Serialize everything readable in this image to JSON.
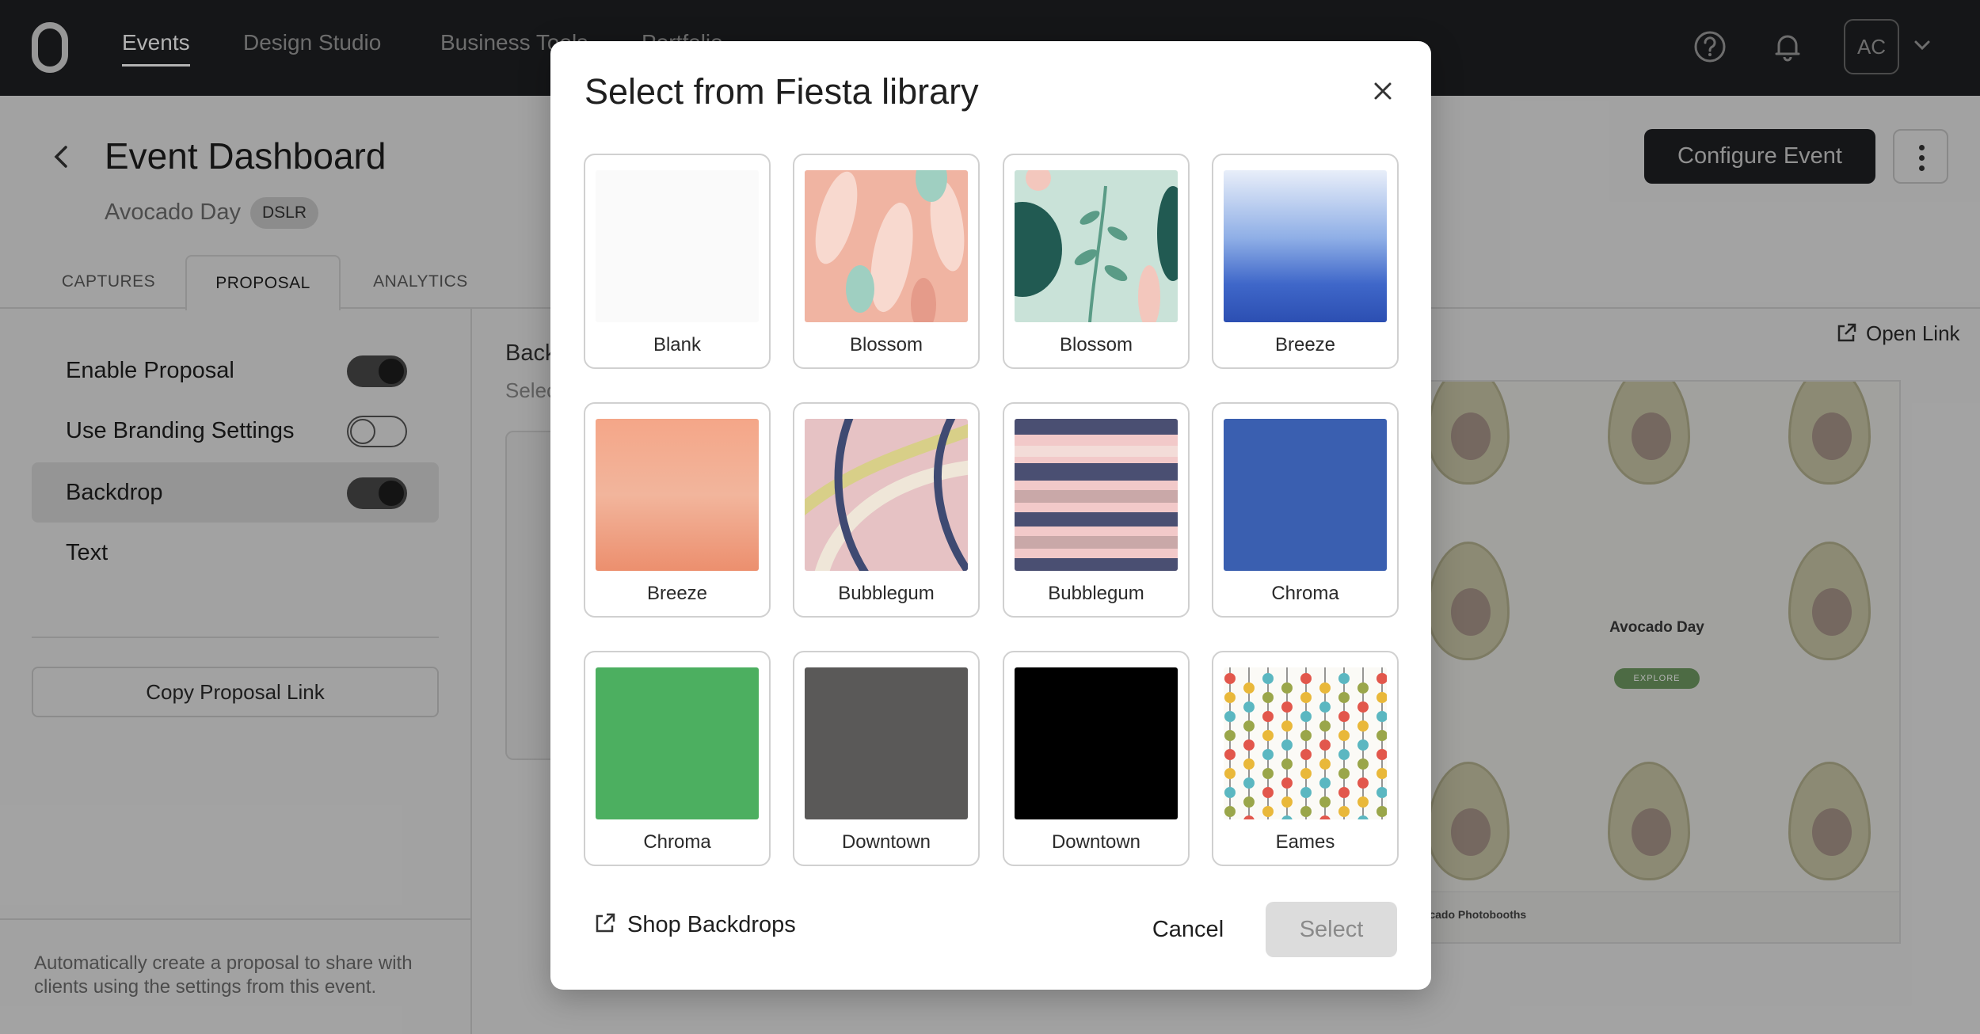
{
  "nav": {
    "items": [
      "Events",
      "Design Studio",
      "Business Tools",
      "Portfolio"
    ],
    "active": "Events",
    "avatar_initials": "AC",
    "icons": [
      "help-icon",
      "bell-icon",
      "chevron-down-icon"
    ]
  },
  "header": {
    "title": "Event Dashboard",
    "event_name": "Avocado Day",
    "badge": "DSLR",
    "configure_label": "Configure Event"
  },
  "tabs": [
    {
      "label": "CAPTURES"
    },
    {
      "label": "PROPOSAL",
      "active": true
    },
    {
      "label": "ANALYTICS"
    }
  ],
  "settings": {
    "items": [
      {
        "label": "Enable Proposal",
        "toggle": true
      },
      {
        "label": "Use Branding Settings",
        "toggle": false
      },
      {
        "label": "Backdrop",
        "toggle": true
      },
      {
        "label": "Text"
      }
    ],
    "copy_label": "Copy Proposal Link",
    "footer_text": "Automatically create a proposal to share with clients using the settings from this event."
  },
  "content": {
    "section_title": "Back",
    "section_sub": "Selec",
    "open_link_label": "Open Link",
    "preview": {
      "title": "Avocado Day",
      "button": "EXPLORE",
      "brand": "vocado Photobooths"
    }
  },
  "modal": {
    "title": "Select from Fiesta library",
    "tiles": [
      {
        "label": "Blank"
      },
      {
        "label": "Blossom"
      },
      {
        "label": "Blossom"
      },
      {
        "label": "Breeze"
      },
      {
        "label": "Breeze"
      },
      {
        "label": "Bubblegum"
      },
      {
        "label": "Bubblegum"
      },
      {
        "label": "Chroma"
      },
      {
        "label": "Chroma"
      },
      {
        "label": "Downtown"
      },
      {
        "label": "Downtown"
      },
      {
        "label": "Eames"
      }
    ],
    "shop_label": "Shop Backdrops",
    "cancel_label": "Cancel",
    "select_label": "Select"
  },
  "colors": {
    "nav_bg": "#1f2023",
    "chroma_blue": "#3a5fb0",
    "chroma_green": "#4caf60",
    "downtown_gray": "#5a5958",
    "downtown_black": "#000000",
    "select_disabled": "#dcdcdc"
  }
}
